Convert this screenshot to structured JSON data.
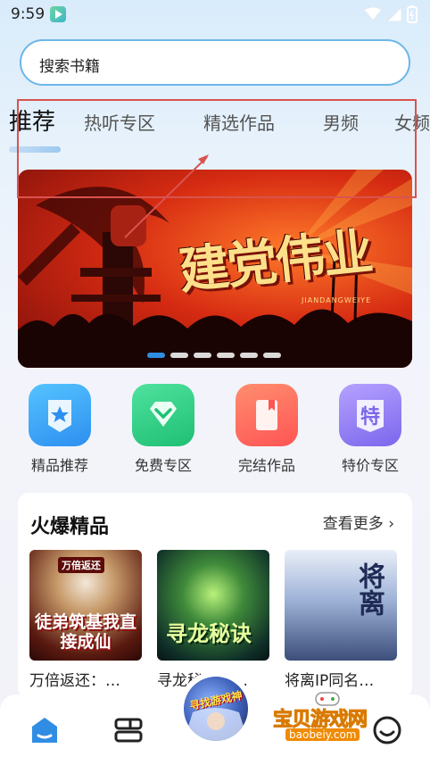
{
  "status_bar": {
    "time": "9:59",
    "icons": [
      "app-icon",
      "wifi-icon",
      "signal-icon",
      "battery-icon"
    ]
  },
  "search": {
    "placeholder": "搜索书籍"
  },
  "tabs": [
    {
      "label": "推荐",
      "active": true
    },
    {
      "label": "热听专区",
      "active": false
    },
    {
      "label": "精选作品",
      "active": false
    },
    {
      "label": "男频",
      "active": false
    },
    {
      "label": "女频",
      "active": false
    }
  ],
  "banner": {
    "title": "建党伟业",
    "subtitle": "JIANDANGWEIYE",
    "slide_count": 6,
    "active_slide": 1
  },
  "quick_entries": [
    {
      "label": "精品推荐",
      "icon": "star-icon",
      "color": "#35a6f2"
    },
    {
      "label": "免费专区",
      "icon": "diamond-icon",
      "color": "#2ed082"
    },
    {
      "label": "完结作品",
      "icon": "book-icon",
      "color": "#ff6a5c"
    },
    {
      "label": "特价专区",
      "icon": "tag-icon",
      "color": "#8f7cf0"
    }
  ],
  "hot_section": {
    "title": "火爆精品",
    "more_label": "查看更多",
    "books": [
      {
        "title": "万倍返还：…",
        "cover_text": "徒弟筑基我直接成仙",
        "cover_tag": "万倍返还"
      },
      {
        "title": "寻龙秘诀：…",
        "cover_text": "寻龙秘诀"
      },
      {
        "title": "将离IP同名…",
        "cover_text": "将离"
      }
    ]
  },
  "fab": {
    "label": "寻找游戏神"
  },
  "watermark": {
    "text": "宝贝游戏网",
    "url": "baobeiy.com"
  },
  "bottom_nav": [
    {
      "name": "home",
      "icon": "home-icon",
      "active": true
    },
    {
      "name": "library",
      "icon": "bookshelf-icon",
      "active": false
    },
    {
      "name": "center",
      "icon": "game-icon",
      "active": false
    },
    {
      "name": "profile",
      "icon": "smile-icon",
      "active": false
    }
  ],
  "colors": {
    "accent": "#2f8de4",
    "annotation": "#d9534f"
  }
}
